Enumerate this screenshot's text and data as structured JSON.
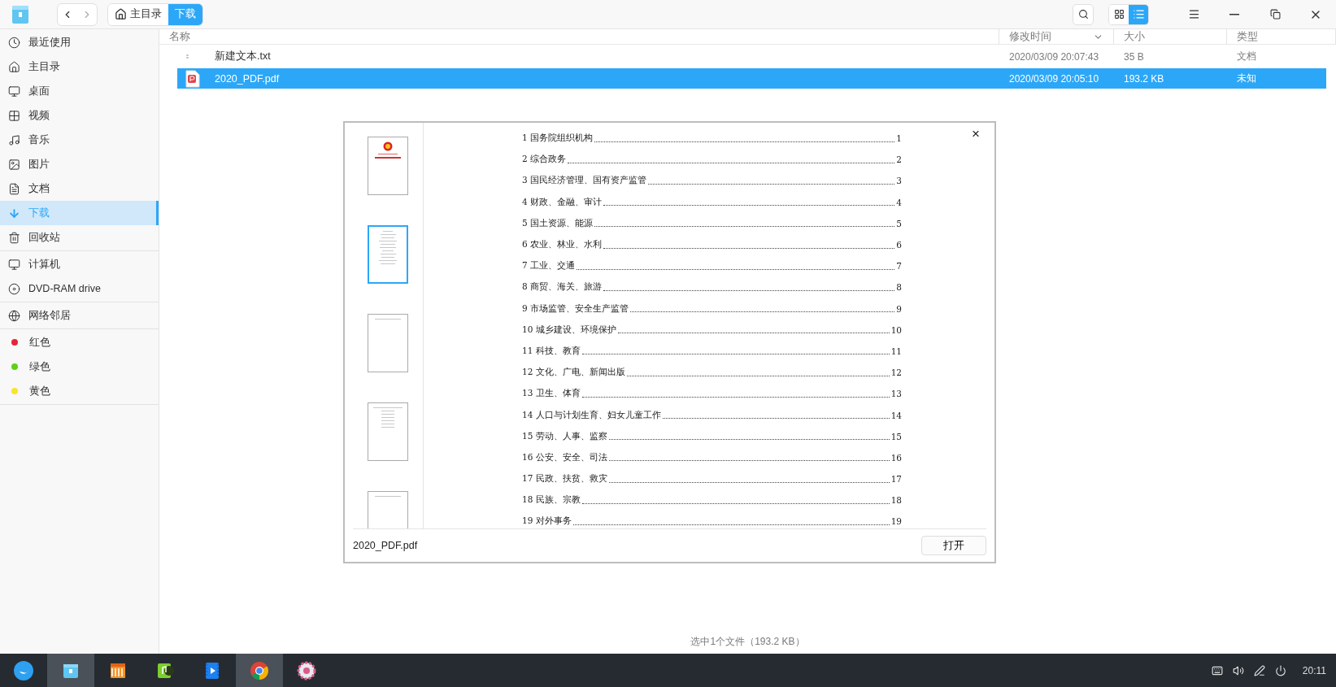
{
  "toolbar": {
    "breadcrumbs": [
      {
        "label": "主目录",
        "kind": "home",
        "selected": false
      },
      {
        "label": "下载",
        "kind": "plain",
        "selected": true
      }
    ],
    "view_buttons": [
      {
        "kind": "grid",
        "selected": false
      },
      {
        "kind": "list",
        "selected": true
      }
    ]
  },
  "sidebar": {
    "groups": [
      [
        {
          "label": "最近使用",
          "kind": "recent",
          "selected": false
        },
        {
          "label": "主目录",
          "kind": "home",
          "selected": false
        },
        {
          "label": "桌面",
          "kind": "desktop",
          "selected": false
        },
        {
          "label": "视频",
          "kind": "video",
          "selected": false
        },
        {
          "label": "音乐",
          "kind": "music",
          "selected": false
        },
        {
          "label": "图片",
          "kind": "picture",
          "selected": false
        },
        {
          "label": "文档",
          "kind": "document",
          "selected": false
        },
        {
          "label": "下载",
          "kind": "download",
          "selected": true
        },
        {
          "label": "回收站",
          "kind": "trash",
          "selected": false
        }
      ],
      [
        {
          "label": "计算机",
          "kind": "computer",
          "selected": false
        },
        {
          "label": "DVD-RAM drive",
          "kind": "disc",
          "selected": false
        }
      ],
      [
        {
          "label": "网络邻居",
          "kind": "network",
          "selected": false
        }
      ],
      [
        {
          "label": "红色",
          "kind": "tag",
          "color": "#e5243b",
          "selected": false
        },
        {
          "label": "绿色",
          "kind": "tag",
          "color": "#5fcf1f",
          "selected": false
        },
        {
          "label": "黄色",
          "kind": "tag",
          "color": "#f8e52c",
          "selected": false
        }
      ]
    ]
  },
  "table": {
    "columns": [
      {
        "label": "名称",
        "sorted": false
      },
      {
        "label": "修改时间",
        "sorted": true
      },
      {
        "label": "大小",
        "sorted": false
      },
      {
        "label": "类型",
        "sorted": false
      }
    ],
    "rows": [
      {
        "kind": "text",
        "name": "新建文本.txt",
        "modified": "2020/03/09 20:07:43",
        "size": "35 B",
        "type": "文档",
        "selected": false
      },
      {
        "kind": "pdf",
        "name": "2020_PDF.pdf",
        "modified": "2020/03/09 20:05:10",
        "size": "193.2 KB",
        "type": "未知",
        "selected": true
      }
    ]
  },
  "preview": {
    "close": "×",
    "thumbnails": [
      {
        "kind": "cover",
        "selected": false
      },
      {
        "kind": "list",
        "selected": true
      },
      {
        "kind": "header",
        "selected": false
      },
      {
        "kind": "table",
        "selected": false
      },
      {
        "kind": "header",
        "selected": false
      }
    ],
    "toc": [
      {
        "title": "1 国务院组织机构",
        "page": "1"
      },
      {
        "title": "2 综合政务",
        "page": "2"
      },
      {
        "title": "3 国民经济管理、国有资产监管",
        "page": "3"
      },
      {
        "title": "4 财政、金融、审计",
        "page": "4"
      },
      {
        "title": "5 国土资源、能源",
        "page": "5"
      },
      {
        "title": "6 农业、林业、水利",
        "page": "6"
      },
      {
        "title": "7 工业、交通",
        "page": "7"
      },
      {
        "title": "8 商贸、海关、旅游",
        "page": "8"
      },
      {
        "title": "9 市场监管、安全生产监管",
        "page": "9"
      },
      {
        "title": "10 城乡建设、环境保护",
        "page": "10"
      },
      {
        "title": "11 科技、教育",
        "page": "11"
      },
      {
        "title": "12 文化、广电、新闻出版",
        "page": "12"
      },
      {
        "title": "13 卫生、体育",
        "page": "13"
      },
      {
        "title": "14 人口与计划生育、妇女儿童工作",
        "page": "14"
      },
      {
        "title": "15 劳动、人事、监察",
        "page": "15"
      },
      {
        "title": "16 公安、安全、司法",
        "page": "16"
      },
      {
        "title": "17 民政、扶贫、救灾",
        "page": "17"
      },
      {
        "title": "18 民族、宗教",
        "page": "18"
      },
      {
        "title": "19 对外事务",
        "page": "19"
      }
    ],
    "filename": "2020_PDF.pdf",
    "open_button": "打开"
  },
  "status_bar": "选中1个文件（193.2 KB）",
  "taskbar": {
    "apps": [
      {
        "kind": "launcher",
        "active": false
      },
      {
        "kind": "files",
        "active": true
      },
      {
        "kind": "store",
        "active": false
      },
      {
        "kind": "music",
        "active": false
      },
      {
        "kind": "video",
        "active": false
      },
      {
        "kind": "browser",
        "active": true
      },
      {
        "kind": "settings",
        "active": false
      }
    ],
    "time": "20:11"
  }
}
